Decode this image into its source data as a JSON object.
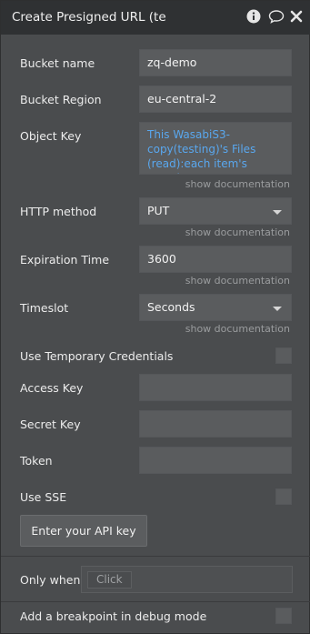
{
  "title": "Create Presigned URL (te",
  "icons": {
    "info": "info-icon",
    "comment": "comment-icon",
    "close": "close-icon"
  },
  "fields": {
    "bucket_name": {
      "label": "Bucket name",
      "value": "zq-demo"
    },
    "bucket_region": {
      "label": "Bucket Region",
      "value": "eu-central-2"
    },
    "object_key": {
      "label": "Object Key",
      "value": "This WasabiS3-copy(testing)'s Files (read):each item's Location",
      "doc": "show documentation"
    },
    "http_method": {
      "label": "HTTP method",
      "value": "PUT",
      "doc": "show documentation"
    },
    "expiration_time": {
      "label": "Expiration Time",
      "value": "3600",
      "doc": "show documentation"
    },
    "timeslot": {
      "label": "Timeslot",
      "value": "Seconds",
      "doc": "show documentation"
    },
    "use_temp_credentials": {
      "label": "Use Temporary Credentials"
    },
    "access_key": {
      "label": "Access Key",
      "value": ""
    },
    "secret_key": {
      "label": "Secret Key",
      "value": ""
    },
    "token": {
      "label": "Token",
      "value": ""
    },
    "use_sse": {
      "label": "Use SSE"
    }
  },
  "api_button_label": "Enter your API key",
  "only_when": {
    "label": "Only when",
    "placeholder": "Click"
  },
  "breakpoint": {
    "label": "Add a breakpoint in debug mode"
  },
  "colors": {
    "link_blue": "#59a7ee",
    "panel_bg": "#4a4c4e",
    "titlebar_bg": "#2f3133",
    "field_bg": "#5a5c5e"
  }
}
